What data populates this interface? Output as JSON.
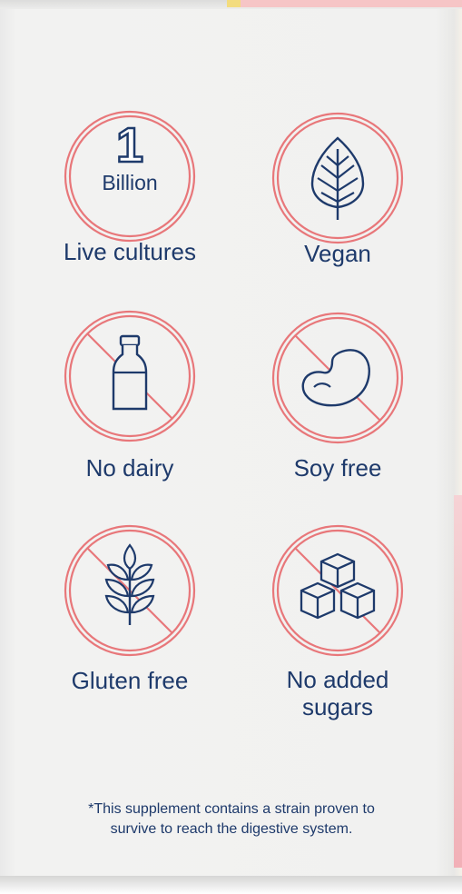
{
  "colors": {
    "ring": "#e8777a",
    "ink": "#1e3a6b",
    "panel": "#f1f1f0"
  },
  "badges": [
    {
      "id": "cultures",
      "icon": "number-one-billion-icon",
      "number": "1",
      "sub": "Billion",
      "label": "Live cultures"
    },
    {
      "id": "vegan",
      "icon": "leaf-icon",
      "label": "Vegan"
    },
    {
      "id": "dairy",
      "icon": "milk-bottle-icon",
      "label": "No dairy"
    },
    {
      "id": "soy",
      "icon": "bean-icon",
      "label": "Soy free"
    },
    {
      "id": "gluten",
      "icon": "wheat-icon",
      "label": "Gluten free"
    },
    {
      "id": "sugar",
      "icon": "sugar-cubes-icon",
      "label_line1": "No added",
      "label_line2": "sugars"
    }
  ],
  "footnote": {
    "line1": "*This supplement contains a strain proven to",
    "line2": "survive to reach the digestive system."
  }
}
